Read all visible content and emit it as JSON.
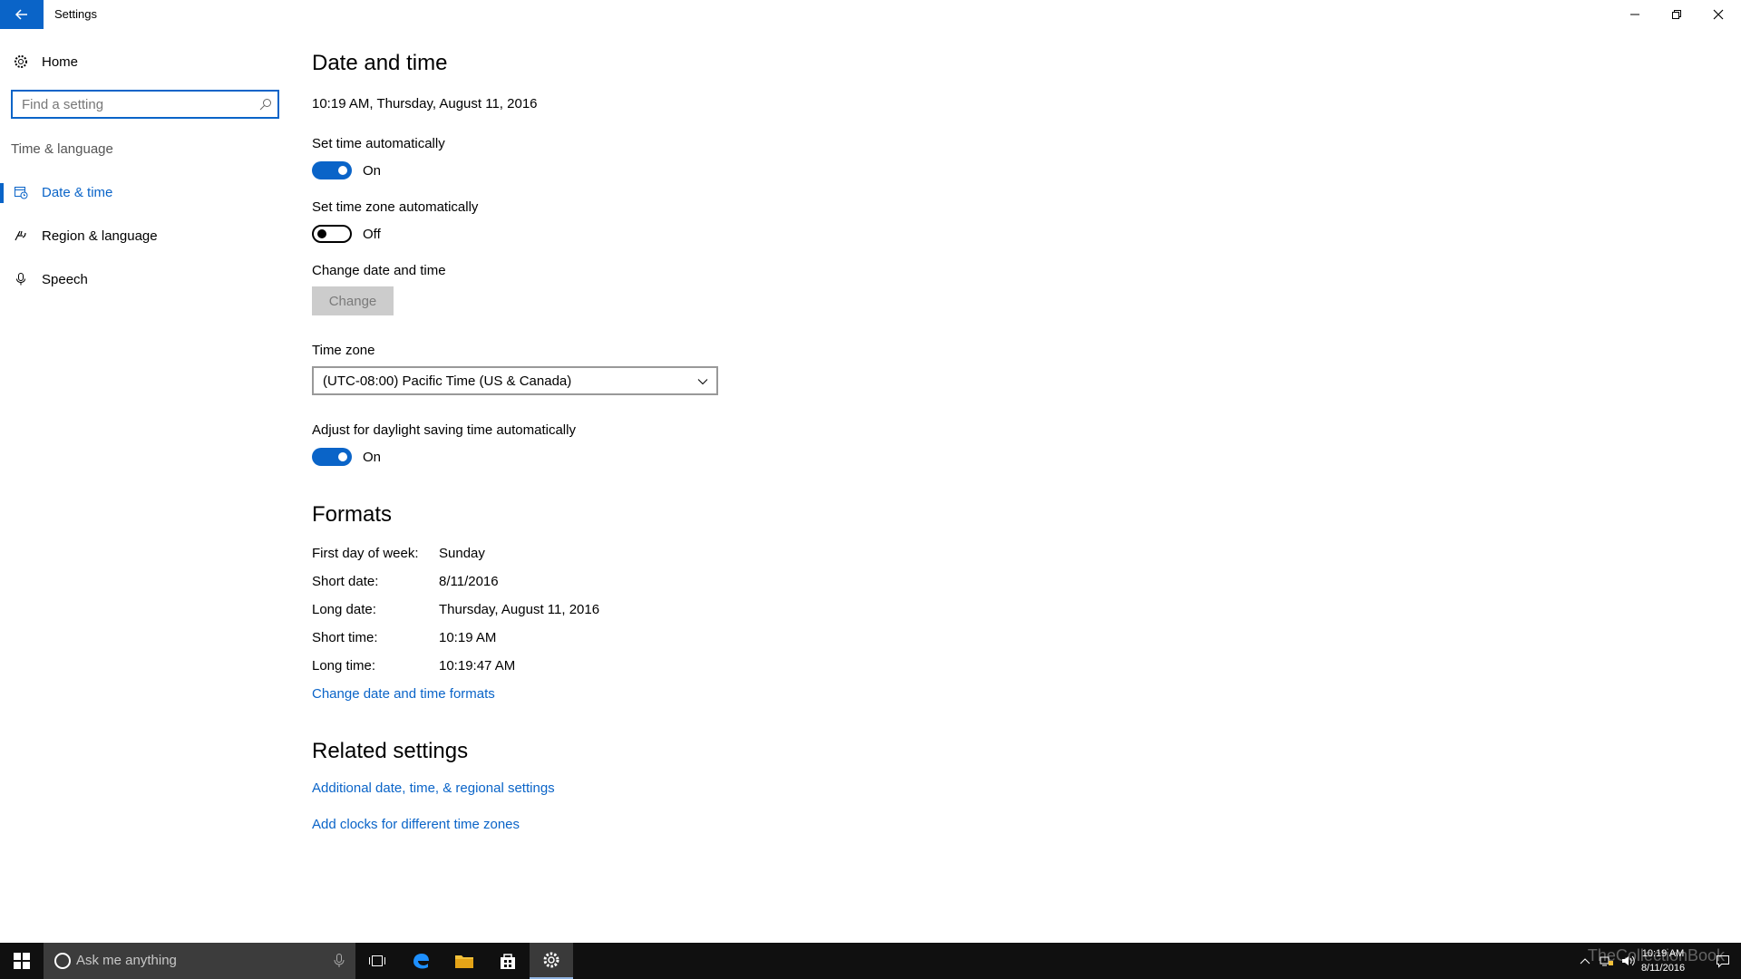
{
  "titlebar": {
    "title": "Settings"
  },
  "sidebar": {
    "home_label": "Home",
    "search_placeholder": "Find a setting",
    "section_label": "Time & language",
    "items": [
      {
        "label": "Date & time",
        "icon": "calendar-clock-icon",
        "active": true
      },
      {
        "label": "Region & language",
        "icon": "region-language-icon",
        "active": false
      },
      {
        "label": "Speech",
        "icon": "microphone-icon",
        "active": false
      }
    ]
  },
  "main": {
    "title": "Date and time",
    "current_datetime": "10:19 AM, Thursday, August 11, 2016",
    "set_time_auto": {
      "label": "Set time automatically",
      "state": "On"
    },
    "set_tz_auto": {
      "label": "Set time zone automatically",
      "state": "Off"
    },
    "change_dt": {
      "label": "Change date and time",
      "button": "Change"
    },
    "time_zone": {
      "label": "Time zone",
      "value": "(UTC-08:00) Pacific Time (US & Canada)"
    },
    "dst": {
      "label": "Adjust for daylight saving time automatically",
      "state": "On"
    },
    "formats": {
      "title": "Formats",
      "rows": [
        {
          "label": "First day of week:",
          "value": "Sunday"
        },
        {
          "label": "Short date:",
          "value": "8/11/2016"
        },
        {
          "label": "Long date:",
          "value": "Thursday, August 11, 2016"
        },
        {
          "label": "Short time:",
          "value": "10:19 AM"
        },
        {
          "label": "Long time:",
          "value": "10:19:47 AM"
        }
      ],
      "link": "Change date and time formats"
    },
    "related": {
      "title": "Related settings",
      "links": [
        "Additional date, time, & regional settings",
        "Add clocks for different time zones"
      ]
    }
  },
  "taskbar": {
    "search_placeholder": "Ask me anything",
    "clock_time": "10:19 AM",
    "clock_date": "8/11/2016",
    "watermark": "TheCollectionBook"
  },
  "colors": {
    "accent": "#0a64c8",
    "taskbar": "#101010"
  }
}
